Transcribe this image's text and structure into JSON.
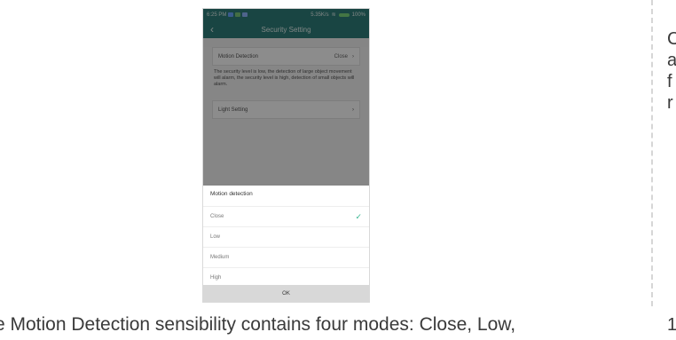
{
  "page": {
    "caption": "e Motion Detection sensibility contains four modes: Close, Low,",
    "right_column": [
      "C",
      "a",
      "f",
      "r"
    ],
    "right_number": "1"
  },
  "phone": {
    "status": {
      "time": "6:25 PM",
      "speed": "5.35K/s",
      "battery": "100%"
    },
    "appbar": {
      "back": "‹",
      "title": "Security Setting"
    },
    "motion_row": {
      "label": "Motion Detection",
      "value": "Close",
      "chevron": "›"
    },
    "description": "The security level is low, the detection of large object movement will alarm, the security level is high, detection of small objects will alarm.",
    "light_row": {
      "label": "Light Setting",
      "chevron": "›"
    },
    "sheet": {
      "title": "Motion detection",
      "options": [
        {
          "label": "Close",
          "selected": true
        },
        {
          "label": "Low",
          "selected": false
        },
        {
          "label": "Medium",
          "selected": false
        },
        {
          "label": "High",
          "selected": false
        }
      ],
      "check": "✓",
      "ok": "OK"
    }
  },
  "colors": {
    "accent": "#2e7f7a",
    "check": "#35b58f"
  },
  "icons": [
    "wifi-icon",
    "battery-icon",
    "back-icon",
    "check-icon",
    "chevron-right-icon"
  ]
}
